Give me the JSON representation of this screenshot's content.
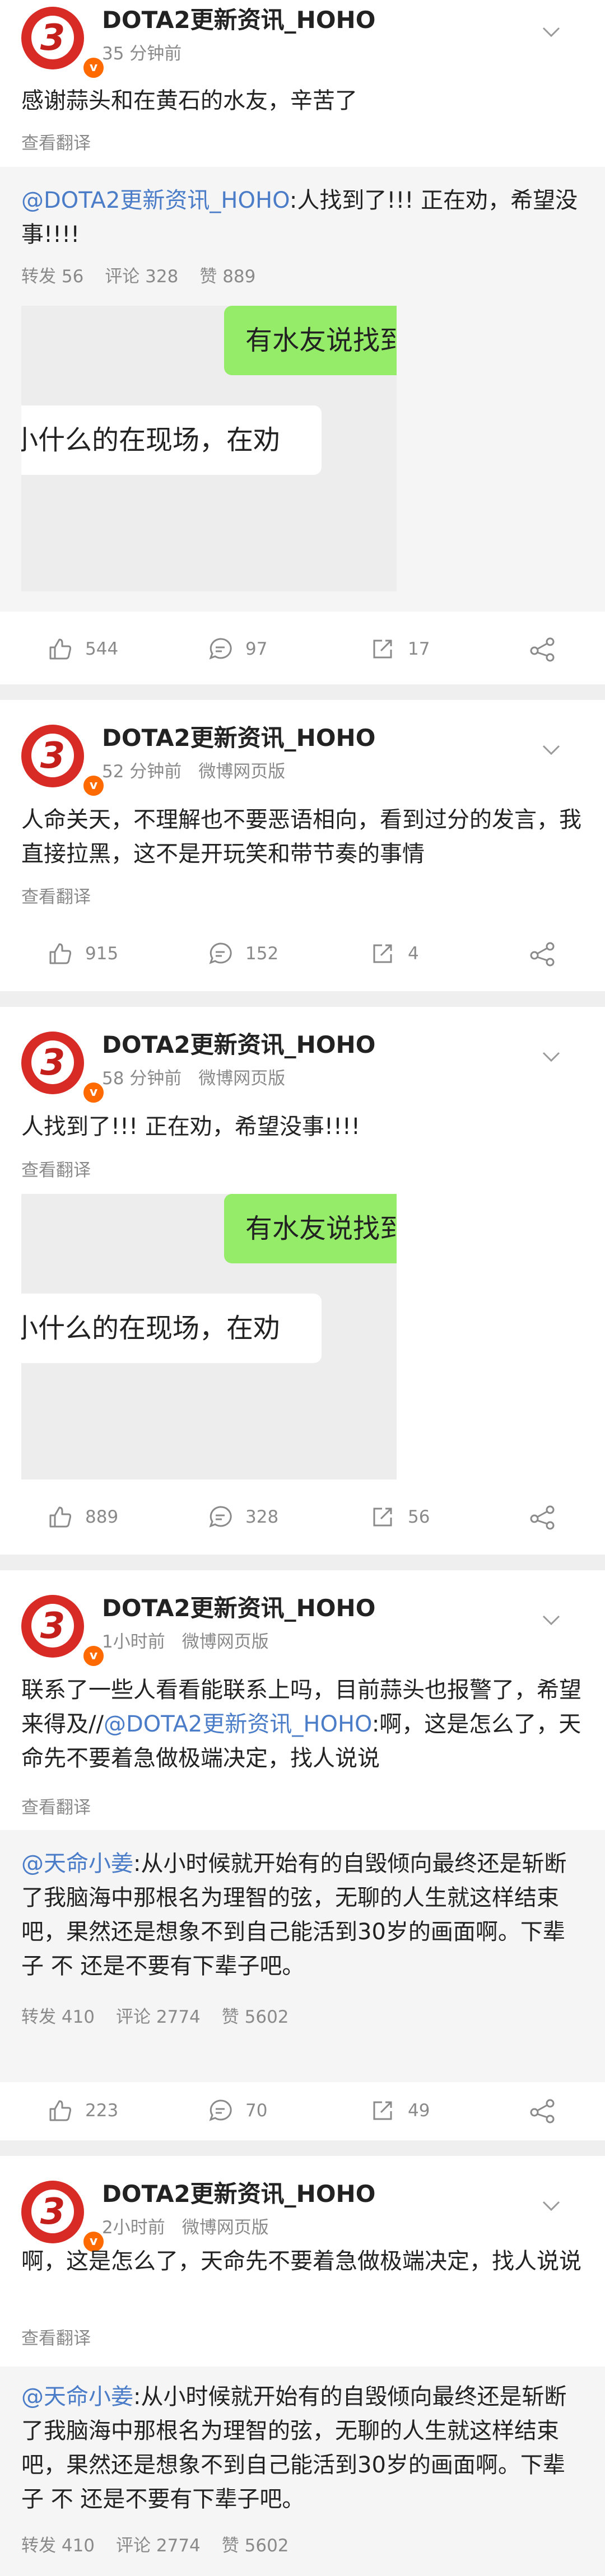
{
  "posts": [
    {
      "author": "DOTA2更新资讯_HOHO",
      "time": "35 分钟前",
      "source": "",
      "text": "感谢蒜头和在黄石的水友，辛苦了",
      "translate": "查看翻译",
      "repost": {
        "mention": "@DOTA2更新资讯_HOHO",
        "text": ":人找到了!!! 正在劝，希望没事!!!!",
        "stats": [
          "转发 56",
          "评论 328",
          "赞 889"
        ],
        "media": {
          "bubble_green": "有水友说找到",
          "bubble_white": "小什么的在现场，在劝"
        }
      },
      "actions": {
        "like": "544",
        "comment": "97",
        "share": "17"
      }
    },
    {
      "author": "DOTA2更新资讯_HOHO",
      "time": "52 分钟前",
      "source": "微博网页版",
      "text": "人命关天，不理解也不要恶语相向，看到过分的发言，我直接拉黑，这不是开玩笑和带节奏的事情",
      "translate": "查看翻译",
      "actions": {
        "like": "915",
        "comment": "152",
        "share": "4"
      }
    },
    {
      "author": "DOTA2更新资讯_HOHO",
      "time": "58 分钟前",
      "source": "微博网页版",
      "text": "人找到了!!! 正在劝，希望没事!!!!",
      "translate": "查看翻译",
      "media": {
        "bubble_green": "有水友说找到",
        "bubble_white": "小什么的在现场，在劝"
      },
      "actions": {
        "like": "889",
        "comment": "328",
        "share": "56"
      }
    },
    {
      "author": "DOTA2更新资讯_HOHO",
      "time": "1小时前",
      "source": "微博网页版",
      "text_before": "联系了一些人看看能联系上吗，目前蒜头也报警了，希望来得及//",
      "text_mention": "@DOTA2更新资讯_HOHO",
      "text_after": ":啊，这是怎么了，天命先不要着急做极端决定，找人说说",
      "translate": "查看翻译",
      "repost": {
        "mention": "@天命小姜",
        "text": ":从小时候就开始有的自毁倾向最终还是斩断了我脑海中那根名为理智的弦，无聊的人生就这样结束吧，果然还是想象不到自己能活到30岁的画面啊。下辈子 不 还是不要有下辈子吧。",
        "stats": [
          "转发 410",
          "评论 2774",
          "赞 5602"
        ]
      },
      "actions": {
        "like": "223",
        "comment": "70",
        "share": "49"
      }
    },
    {
      "author": "DOTA2更新资讯_HOHO",
      "time": "2小时前",
      "source": "微博网页版",
      "text": "啊，这是怎么了，天命先不要着急做极端决定，找人说说",
      "translate": "查看翻译",
      "repost": {
        "mention": "@天命小姜",
        "text": ":从小时候就开始有的自毁倾向最终还是斩断了我脑海中那根名为理智的弦，无聊的人生就这样结束吧，果然还是想象不到自己能活到30岁的画面啊。下辈子 不 还是不要有下辈子吧。",
        "stats": [
          "转发 410",
          "评论 2774",
          "赞 5602"
        ]
      }
    }
  ],
  "colors": {
    "link": "#4a7cc8",
    "green_bubble": "#95ec69",
    "meta": "#8a8a8a",
    "avatar_red": "#d92b26"
  },
  "icons": [
    "like-icon",
    "comment-icon",
    "share-icon",
    "more-share-icon",
    "chevron-down-icon",
    "verified-icon"
  ]
}
